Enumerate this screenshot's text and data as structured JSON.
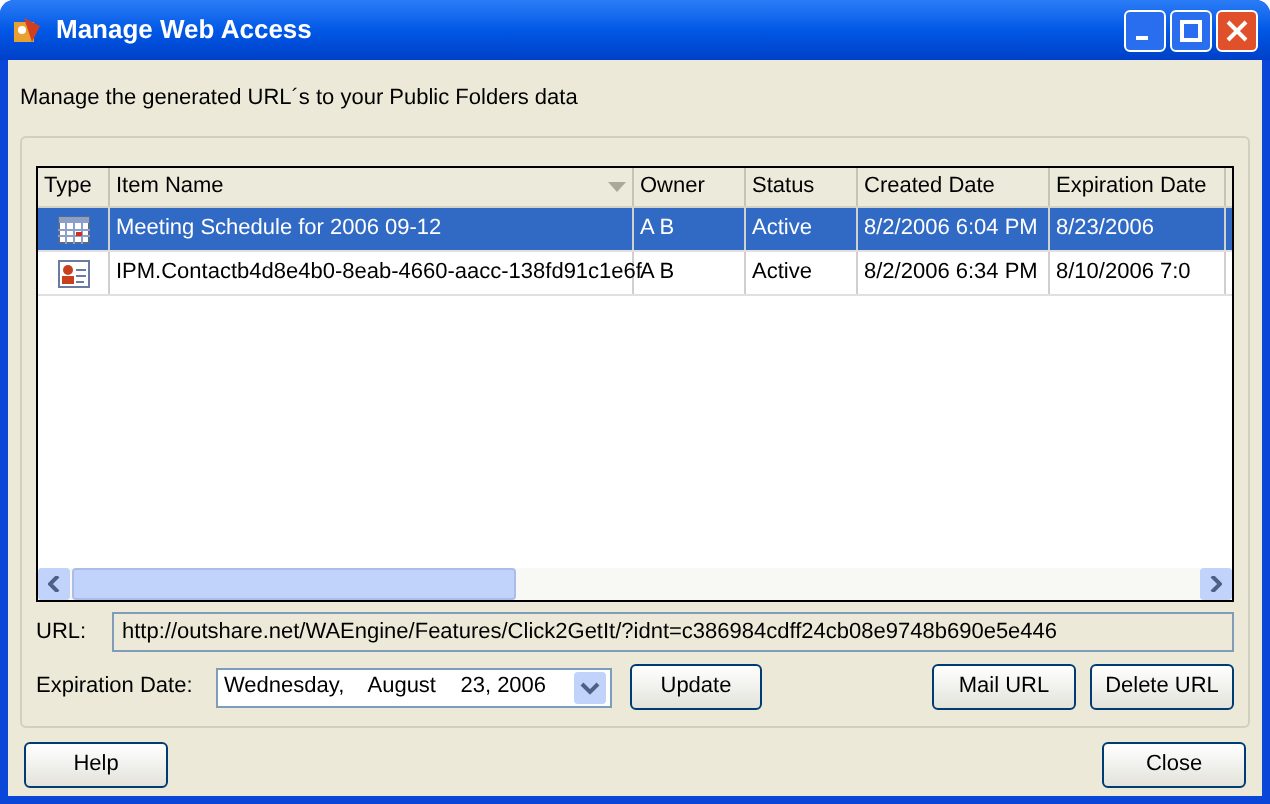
{
  "window": {
    "title": "Manage Web Access"
  },
  "description": "Manage the generated URL´s to your Public Folders data",
  "table": {
    "columns": [
      "Type",
      "Item Name",
      "Owner",
      "Status",
      "Created Date",
      "Expiration Date"
    ],
    "rows": [
      {
        "kind": "calendar",
        "selected": true,
        "item_name": "Meeting Schedule for 2006 09-12",
        "owner": "A B",
        "status": "Active",
        "created_date": "8/2/2006 6:04 PM",
        "expiration_date": "8/23/2006"
      },
      {
        "kind": "contact",
        "selected": false,
        "item_name": "IPM.Contactb4d8e4b0-8eab-4660-aacc-138fd91c1e6f",
        "owner": "A B",
        "status": "Active",
        "created_date": "8/2/2006 6:34 PM",
        "expiration_date": "8/10/2006 7:0"
      }
    ]
  },
  "url": {
    "label": "URL:",
    "value": "http://outshare.net/WAEngine/Features/Click2GetIt/?idnt=c386984cdff24cb08e9748b690e5e446"
  },
  "expiration": {
    "label": "Expiration Date:",
    "value": "Wednesday,    August    23, 2006"
  },
  "buttons": {
    "update": "Update",
    "mail": "Mail URL",
    "delete": "Delete URL",
    "help": "Help",
    "close": "Close"
  }
}
